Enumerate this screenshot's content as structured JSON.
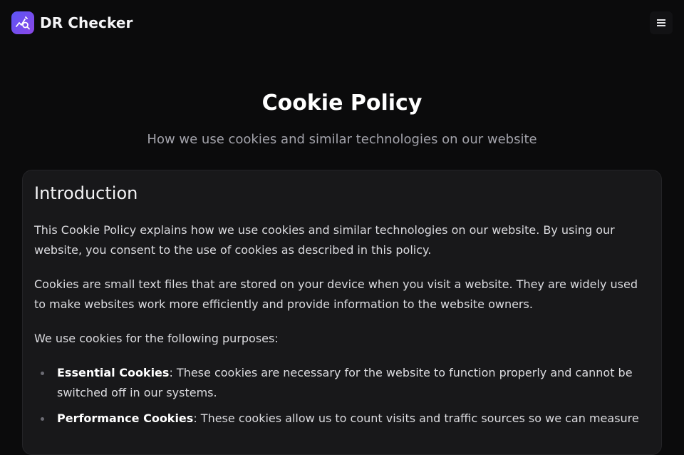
{
  "header": {
    "brand_name": "DR Checker",
    "menu_icon": "☰"
  },
  "hero": {
    "title": "Cookie Policy",
    "subtitle": "How we use cookies and similar technologies on our website"
  },
  "section": {
    "heading": "Introduction",
    "paragraphs": [
      "This Cookie Policy explains how we use cookies and similar technologies on our website. By using our website, you consent to the use of cookies as described in this policy.",
      "Cookies are small text files that are stored on your device when you visit a website. They are widely used to make websites work more efficiently and provide information to the website owners.",
      "We use cookies for the following purposes:"
    ],
    "list": [
      {
        "term": "Essential Cookies",
        "text": ": These cookies are necessary for the website to function properly and cannot be switched off in our systems."
      },
      {
        "term": "Performance Cookies",
        "text": ": These cookies allow us to count visits and traffic sources so we can measure"
      }
    ]
  },
  "colors": {
    "background": "#0b0b0c",
    "card": "#18181a",
    "logo_gradient_start": "#5b55f5",
    "logo_gradient_end": "#8b47e6"
  }
}
